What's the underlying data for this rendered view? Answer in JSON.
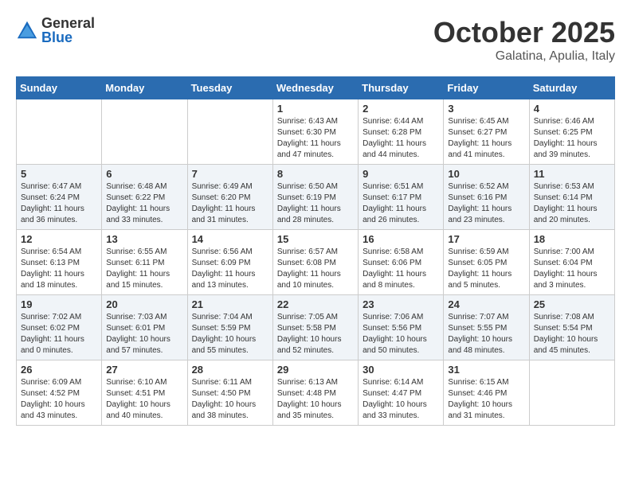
{
  "header": {
    "logo_general": "General",
    "logo_blue": "Blue",
    "month": "October 2025",
    "location": "Galatina, Apulia, Italy"
  },
  "days_of_week": [
    "Sunday",
    "Monday",
    "Tuesday",
    "Wednesday",
    "Thursday",
    "Friday",
    "Saturday"
  ],
  "weeks": [
    [
      {
        "num": "",
        "info": ""
      },
      {
        "num": "",
        "info": ""
      },
      {
        "num": "",
        "info": ""
      },
      {
        "num": "1",
        "info": "Sunrise: 6:43 AM\nSunset: 6:30 PM\nDaylight: 11 hours and 47 minutes."
      },
      {
        "num": "2",
        "info": "Sunrise: 6:44 AM\nSunset: 6:28 PM\nDaylight: 11 hours and 44 minutes."
      },
      {
        "num": "3",
        "info": "Sunrise: 6:45 AM\nSunset: 6:27 PM\nDaylight: 11 hours and 41 minutes."
      },
      {
        "num": "4",
        "info": "Sunrise: 6:46 AM\nSunset: 6:25 PM\nDaylight: 11 hours and 39 minutes."
      }
    ],
    [
      {
        "num": "5",
        "info": "Sunrise: 6:47 AM\nSunset: 6:24 PM\nDaylight: 11 hours and 36 minutes."
      },
      {
        "num": "6",
        "info": "Sunrise: 6:48 AM\nSunset: 6:22 PM\nDaylight: 11 hours and 33 minutes."
      },
      {
        "num": "7",
        "info": "Sunrise: 6:49 AM\nSunset: 6:20 PM\nDaylight: 11 hours and 31 minutes."
      },
      {
        "num": "8",
        "info": "Sunrise: 6:50 AM\nSunset: 6:19 PM\nDaylight: 11 hours and 28 minutes."
      },
      {
        "num": "9",
        "info": "Sunrise: 6:51 AM\nSunset: 6:17 PM\nDaylight: 11 hours and 26 minutes."
      },
      {
        "num": "10",
        "info": "Sunrise: 6:52 AM\nSunset: 6:16 PM\nDaylight: 11 hours and 23 minutes."
      },
      {
        "num": "11",
        "info": "Sunrise: 6:53 AM\nSunset: 6:14 PM\nDaylight: 11 hours and 20 minutes."
      }
    ],
    [
      {
        "num": "12",
        "info": "Sunrise: 6:54 AM\nSunset: 6:13 PM\nDaylight: 11 hours and 18 minutes."
      },
      {
        "num": "13",
        "info": "Sunrise: 6:55 AM\nSunset: 6:11 PM\nDaylight: 11 hours and 15 minutes."
      },
      {
        "num": "14",
        "info": "Sunrise: 6:56 AM\nSunset: 6:09 PM\nDaylight: 11 hours and 13 minutes."
      },
      {
        "num": "15",
        "info": "Sunrise: 6:57 AM\nSunset: 6:08 PM\nDaylight: 11 hours and 10 minutes."
      },
      {
        "num": "16",
        "info": "Sunrise: 6:58 AM\nSunset: 6:06 PM\nDaylight: 11 hours and 8 minutes."
      },
      {
        "num": "17",
        "info": "Sunrise: 6:59 AM\nSunset: 6:05 PM\nDaylight: 11 hours and 5 minutes."
      },
      {
        "num": "18",
        "info": "Sunrise: 7:00 AM\nSunset: 6:04 PM\nDaylight: 11 hours and 3 minutes."
      }
    ],
    [
      {
        "num": "19",
        "info": "Sunrise: 7:02 AM\nSunset: 6:02 PM\nDaylight: 11 hours and 0 minutes."
      },
      {
        "num": "20",
        "info": "Sunrise: 7:03 AM\nSunset: 6:01 PM\nDaylight: 10 hours and 57 minutes."
      },
      {
        "num": "21",
        "info": "Sunrise: 7:04 AM\nSunset: 5:59 PM\nDaylight: 10 hours and 55 minutes."
      },
      {
        "num": "22",
        "info": "Sunrise: 7:05 AM\nSunset: 5:58 PM\nDaylight: 10 hours and 52 minutes."
      },
      {
        "num": "23",
        "info": "Sunrise: 7:06 AM\nSunset: 5:56 PM\nDaylight: 10 hours and 50 minutes."
      },
      {
        "num": "24",
        "info": "Sunrise: 7:07 AM\nSunset: 5:55 PM\nDaylight: 10 hours and 48 minutes."
      },
      {
        "num": "25",
        "info": "Sunrise: 7:08 AM\nSunset: 5:54 PM\nDaylight: 10 hours and 45 minutes."
      }
    ],
    [
      {
        "num": "26",
        "info": "Sunrise: 6:09 AM\nSunset: 4:52 PM\nDaylight: 10 hours and 43 minutes."
      },
      {
        "num": "27",
        "info": "Sunrise: 6:10 AM\nSunset: 4:51 PM\nDaylight: 10 hours and 40 minutes."
      },
      {
        "num": "28",
        "info": "Sunrise: 6:11 AM\nSunset: 4:50 PM\nDaylight: 10 hours and 38 minutes."
      },
      {
        "num": "29",
        "info": "Sunrise: 6:13 AM\nSunset: 4:48 PM\nDaylight: 10 hours and 35 minutes."
      },
      {
        "num": "30",
        "info": "Sunrise: 6:14 AM\nSunset: 4:47 PM\nDaylight: 10 hours and 33 minutes."
      },
      {
        "num": "31",
        "info": "Sunrise: 6:15 AM\nSunset: 4:46 PM\nDaylight: 10 hours and 31 minutes."
      },
      {
        "num": "",
        "info": ""
      }
    ]
  ]
}
